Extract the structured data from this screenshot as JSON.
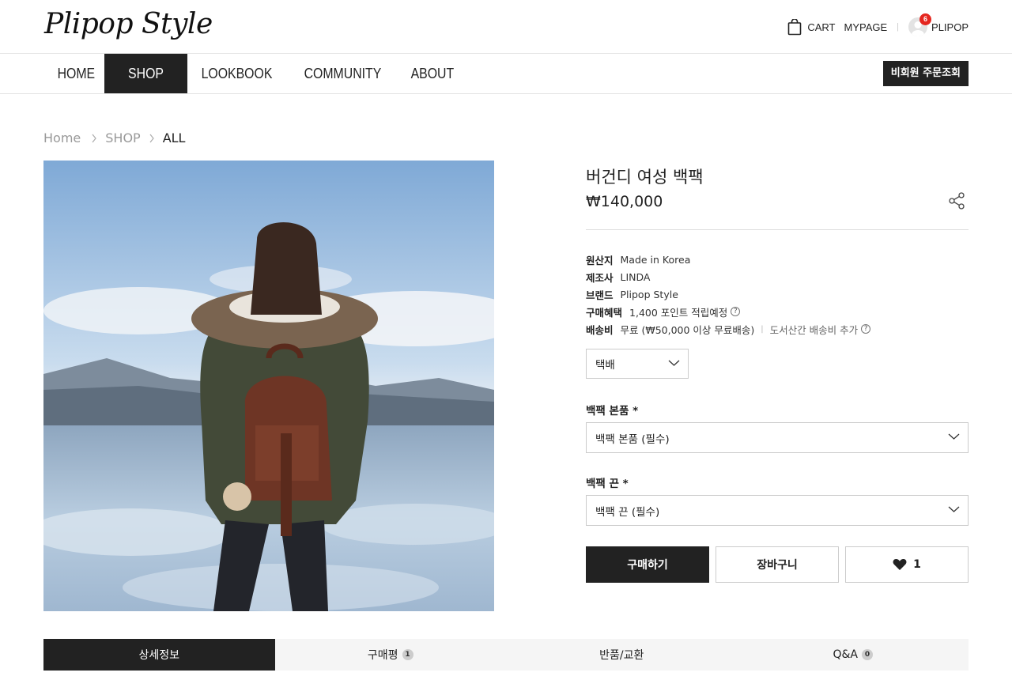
{
  "header": {
    "logo": "Plipop Style",
    "cart_label": "CART",
    "mypage_label": "MYPAGE",
    "separator": "|",
    "notification_count": "6",
    "user_name": "PLIPOP"
  },
  "nav": {
    "items": [
      {
        "label": "HOME"
      },
      {
        "label": "SHOP",
        "active": true
      },
      {
        "label": "LOOKBOOK"
      },
      {
        "label": "COMMUNITY"
      },
      {
        "label": "ABOUT"
      }
    ],
    "guest_order_button": "비회원 주문조회"
  },
  "breadcrumb": {
    "items": [
      "Home",
      "SHOP",
      "ALL"
    ]
  },
  "product": {
    "image_alt": "버건디 여성 백팩",
    "title": "버건디 여성 백팩",
    "price": "₩140,000",
    "specs": {
      "origin_key": "원산지",
      "origin_value": "Made in Korea",
      "maker_key": "제조사",
      "maker_value": "LINDA",
      "brand_key": "브랜드",
      "brand_value": "Plipop Style",
      "benefit_key": "구매혜택",
      "benefit_value": "1,400 포인트 적립예정",
      "shipping_key": "배송비",
      "shipping_value": "무료 (₩50,000 이상 무료배송)",
      "shipping_separator": "|",
      "shipping_extra": "도서산간 배송비 추가",
      "help_symbol": "?"
    },
    "shipping_method": "택배",
    "option1": {
      "label": "백팩 본품 *",
      "value": "백팩 본품 (필수)"
    },
    "option2": {
      "label": "백팩 끈 *",
      "value": "백팩 끈 (필수)"
    },
    "buy_button": "구매하기",
    "cart_button": "장바구니",
    "like_count": "1"
  },
  "tabs": [
    {
      "label": "상세정보",
      "active": true
    },
    {
      "label": "구매평",
      "count": "1"
    },
    {
      "label": "반품/교환"
    },
    {
      "label": "Q&A",
      "count": "0"
    }
  ],
  "colors": {
    "primary": "#222222",
    "badge": "#e5261f",
    "border": "#cccccc",
    "tab_bg": "#f5f5f5"
  },
  "icons": [
    "cart-icon",
    "avatar-icon",
    "share-icon",
    "help-icon",
    "chevron-down-icon",
    "heart-icon",
    "breadcrumb-chevron-icon"
  ]
}
